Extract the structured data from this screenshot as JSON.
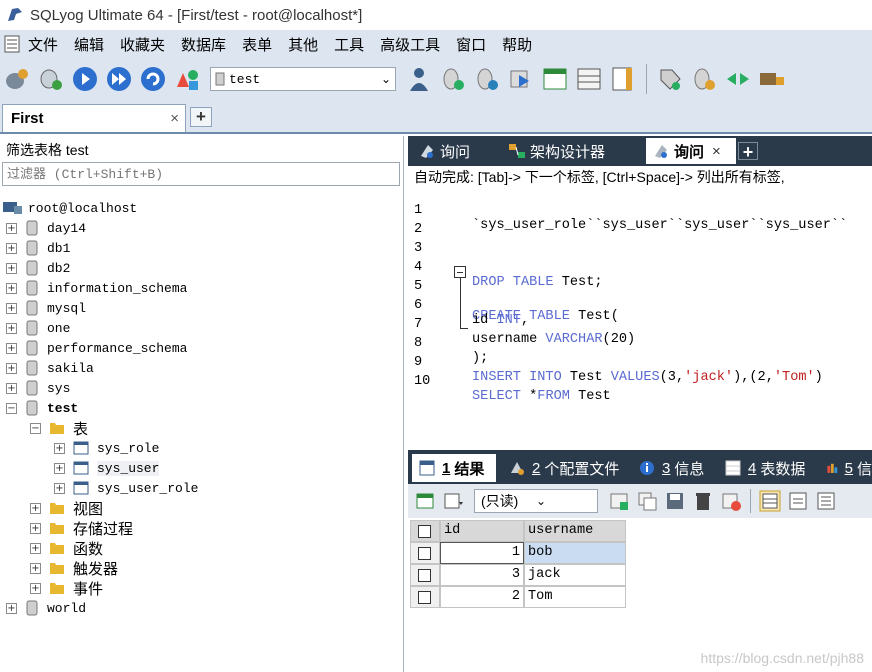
{
  "window": {
    "title": "SQLyog Ultimate 64 - [First/test - root@localhost*]"
  },
  "menu": [
    "文件",
    "编辑",
    "收藏夹",
    "数据库",
    "表单",
    "其他",
    "工具",
    "高级工具",
    "窗口",
    "帮助"
  ],
  "toolbar": {
    "database_selected": "test"
  },
  "connection_tab": {
    "label": "First",
    "close": "×",
    "add": "+"
  },
  "filter": {
    "label": "筛选表格 test",
    "placeholder": "过滤器 (Ctrl+Shift+B)"
  },
  "tree": {
    "root": "root@localhost",
    "databases": [
      "day14",
      "db1",
      "db2",
      "information_schema",
      "mysql",
      "one",
      "performance_schema",
      "sakila",
      "sys",
      "test",
      "world"
    ],
    "expanded_db": "test",
    "tables_folder": "表",
    "tables": [
      "sys_role",
      "sys_user",
      "sys_user_role"
    ],
    "other_folders": [
      "视图",
      "存储过程",
      "函数",
      "触发器",
      "事件"
    ],
    "expander_plus": "+",
    "expander_minus": "−"
  },
  "query_tabs": [
    {
      "label": "询问"
    },
    {
      "label": "架构设计器"
    },
    {
      "label": "询问",
      "close": "×"
    }
  ],
  "query_tab_add": "+",
  "autocomplete_hint": "自动完成: [Tab]-> 下一个标签, [Ctrl+Space]-> 列出所有标签,",
  "editor": {
    "line_numbers": [
      "1",
      "2",
      "3",
      "4",
      "5",
      "6",
      "7",
      "8",
      "9",
      "10"
    ],
    "line1": "`sys_user_role``sys_user``sys_user``sys_user``",
    "l4_kw": "DROP TABLE",
    "l4_rest": " Test;",
    "l5_kw": "CREATE TABLE",
    "l5_rest": " Test(",
    "l6_a": "id ",
    "l6_kw": "INT",
    "l6_b": ",",
    "l7_a": "username ",
    "l7_kw": "VARCHAR",
    "l7_b": "(20)",
    "l8": ");",
    "l9_kw1": "INSERT INTO",
    "l9_a": " Test ",
    "l9_kw2": "VALUES",
    "l9_b": "(3,",
    "l9_s1": "'jack'",
    "l9_c": "),(2,",
    "l9_s2": "'Tom'",
    "l9_d": ")",
    "l10_kw1": "SELECT",
    "l10_a": " *",
    "l10_kw2": "FROM",
    "l10_b": " Test"
  },
  "result_tabs": [
    {
      "num": "1",
      "label": "结果"
    },
    {
      "num": "2",
      "label": "个配置文件"
    },
    {
      "num": "3",
      "label": "信息"
    },
    {
      "num": "4",
      "label": "表数据"
    },
    {
      "num": "5",
      "label": "信"
    }
  ],
  "result_toolbar": {
    "mode": "(只读)"
  },
  "result_grid": {
    "columns": [
      "id",
      "username"
    ],
    "rows": [
      {
        "id": "1",
        "username": "bob"
      },
      {
        "id": "3",
        "username": "jack"
      },
      {
        "id": "2",
        "username": "Tom"
      }
    ]
  },
  "watermark": "https://blog.csdn.net/pjh88",
  "colors": {
    "menubar_bg": "#dde6f0",
    "tab_dark": "#2b3a4a",
    "keyword": "#5a6bd1",
    "string": "#c02020",
    "selected_row": "#c9dcf2"
  }
}
